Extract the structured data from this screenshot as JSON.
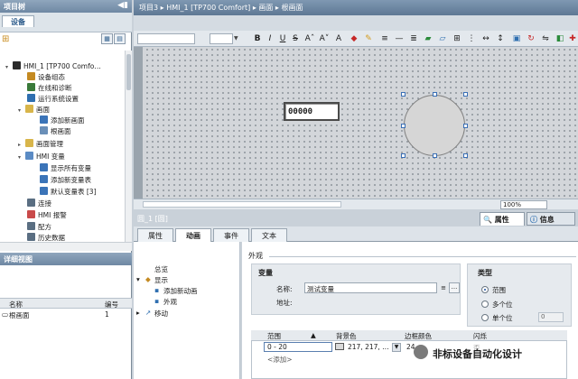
{
  "left_panel": {
    "title": "项目树",
    "device_tab": "设备",
    "tree": [
      {
        "label": "HMI_1 [TP700 Comfo…",
        "color": "#2b2b2b"
      },
      {
        "label": "设备组态",
        "color": "#c48a22"
      },
      {
        "label": "在线和诊断",
        "color": "#3a7a3a"
      },
      {
        "label": "运行系统设置",
        "color": "#2f6fb0"
      },
      {
        "label": "画面",
        "color": "#d8b54a"
      },
      {
        "label": "添加新画面",
        "color": "#3b74b8"
      },
      {
        "label": "根画面",
        "color": "#6a8fb8"
      },
      {
        "label": "画面管理",
        "color": "#d8b54a"
      },
      {
        "label": "HMI 变量",
        "color": "#5b8bc4"
      },
      {
        "label": "显示所有变量",
        "color": "#3b74b8"
      },
      {
        "label": "添加新变量表",
        "color": "#3b74b8"
      },
      {
        "label": "默认变量表 [3]",
        "color": "#3b74b8"
      },
      {
        "label": "连接",
        "color": "#5a6e82"
      },
      {
        "label": "HMI 报警",
        "color": "#c94a4a"
      },
      {
        "label": "配方",
        "color": "#5a6e82"
      },
      {
        "label": "历史数据",
        "color": "#5a6e82"
      }
    ]
  },
  "detail_view": {
    "title": "详细视图",
    "col_name": "名称",
    "col_number": "编号",
    "row_name": "根画面",
    "row_number": "1"
  },
  "main_header": {
    "path": "项目3  ▸  HMI_1 [TP700 Comfort]  ▸  画面  ▸  根画面"
  },
  "toolbar": {
    "bold": "B",
    "italic": "I",
    "underline": "U",
    "strike": "S",
    "font_size_up": "Aˆ",
    "font_size_down": "A˅"
  },
  "canvas": {
    "io_field_value": "00000",
    "zoom": "100%"
  },
  "inspector": {
    "object_title": "圆_1 [圆]",
    "tab_properties": "属性",
    "tab_info": "信息",
    "subtabs": [
      "属性",
      "动画",
      "事件",
      "文本"
    ],
    "nav": {
      "overview": "总览",
      "display": "显示",
      "add_animation": "添加新动画",
      "appearance": "外观",
      "movement": "移动"
    },
    "section_title": "外观",
    "variable_group": "变量",
    "name_label": "名称:",
    "name_value": "测试变量",
    "browse": "...",
    "address_label": "地址:",
    "type_group": "类型",
    "type_range": "范围",
    "type_multi_bit": "多个位",
    "type_single_bit": "单个位",
    "bit_value": "0",
    "table": {
      "col_range": "范围",
      "col_bg": "背景色",
      "col_border": "边框颜色",
      "col_blink": "闪烁",
      "row_range": "0 - 20",
      "row_bg": "217, 217, …",
      "row_border": "24,",
      "row_blink": "否",
      "add_row": "<添加>"
    }
  },
  "watermark": "非标设备自动化设计"
}
